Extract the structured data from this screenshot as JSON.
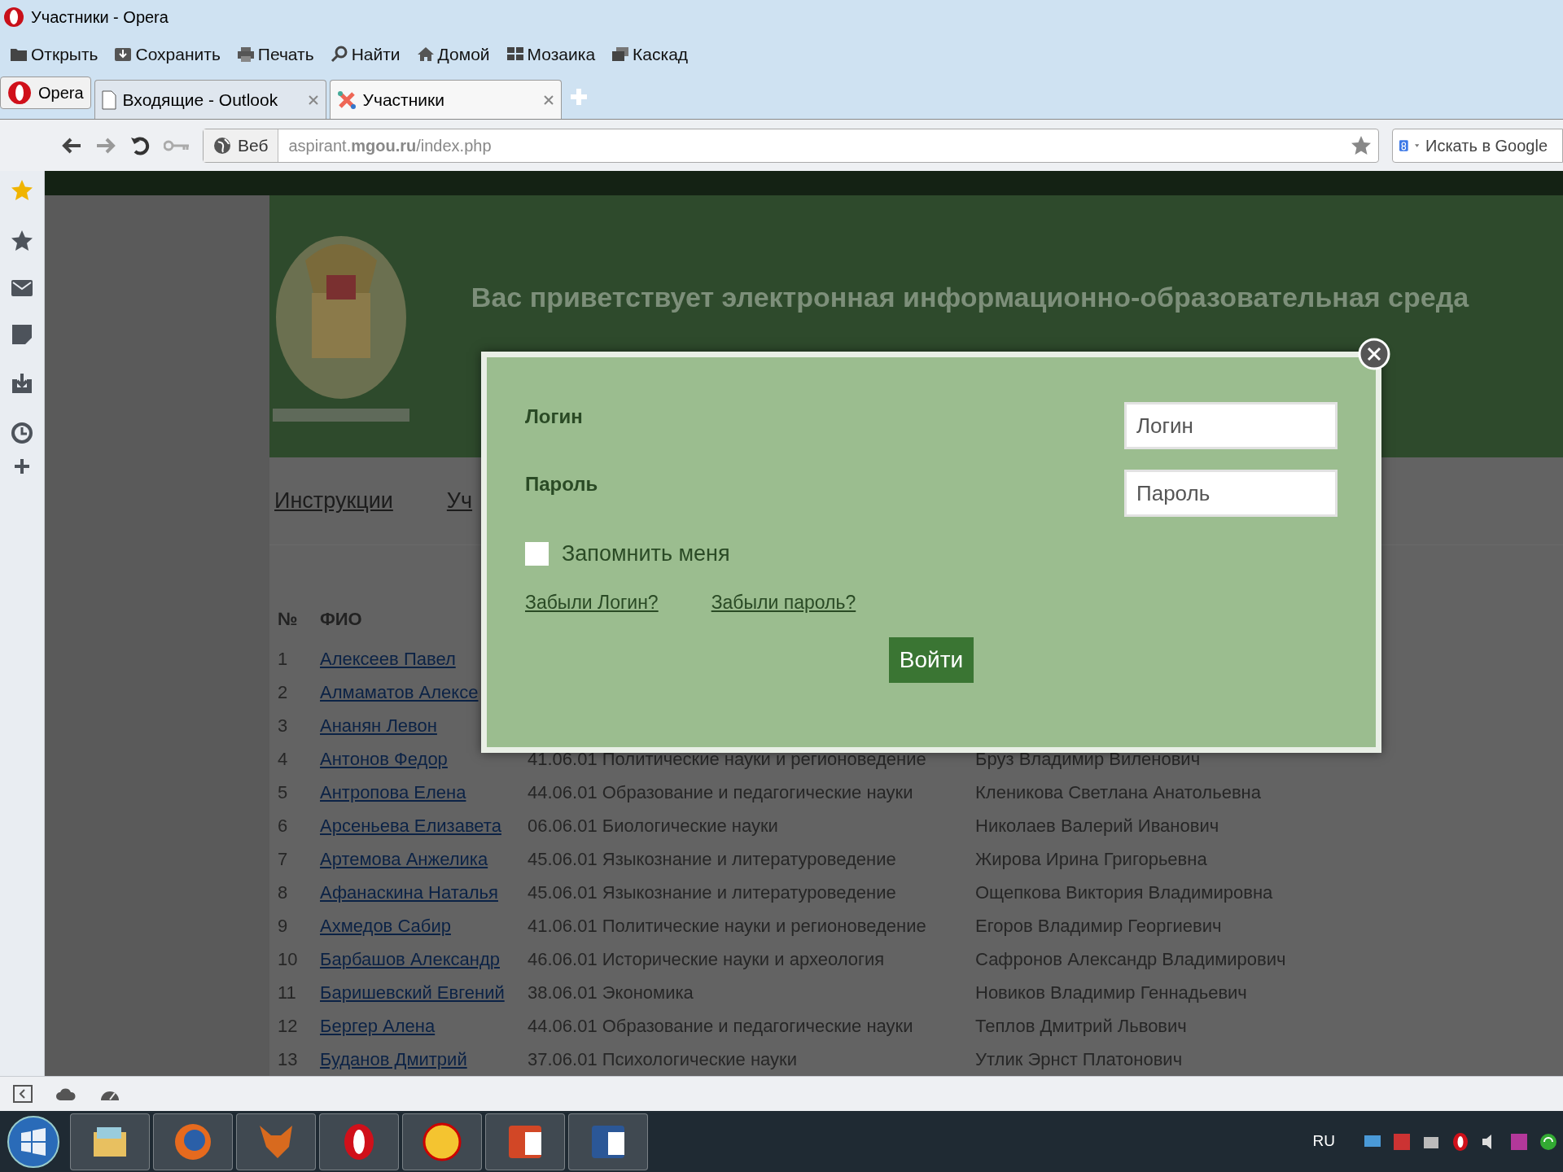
{
  "window": {
    "title": "Участники - Opera"
  },
  "menu": [
    {
      "label": "Открыть",
      "kind": "folder"
    },
    {
      "label": "Сохранить",
      "kind": "save"
    },
    {
      "label": "Печать",
      "kind": "print"
    },
    {
      "label": "Найти",
      "kind": "search"
    },
    {
      "label": "Домой",
      "kind": "home"
    },
    {
      "label": "Мозаика",
      "kind": "tile"
    },
    {
      "label": "Каскад",
      "kind": "cascade"
    }
  ],
  "opera_button": {
    "label": "Opera"
  },
  "tabs": [
    {
      "label": "Входящие - Outlook",
      "kind": "page",
      "selected": false
    },
    {
      "label": "Участники",
      "kind": "site",
      "selected": true
    }
  ],
  "address": {
    "badge": "Веб",
    "url": "aspirant.**mgou.ru**/index.php"
  },
  "search": {
    "placeholder": "Искать в Google"
  },
  "page": {
    "greeting": "Вас приветствует электронная информационно-образовательная среда",
    "nav": [
      "Инструкции",
      "Уч"
    ],
    "table": {
      "columns": [
        "№",
        "ФИО"
      ],
      "rows": [
        {
          "number": "1",
          "name": "Алексеев Павел"
        },
        {
          "number": "2",
          "name": "Алмаматов Алексе"
        },
        {
          "number": "3",
          "name": "Ананян Левон"
        },
        {
          "number": "4",
          "name": "Антонов Федор",
          "direction": "41.06.01 Политические науки и регионоведение",
          "supervisor": "Бруз Владимир Виленович"
        },
        {
          "number": "5",
          "name": "Антропова Елена",
          "direction": "44.06.01 Образование и педагогические науки",
          "supervisor": "Кленикова Светлана Анатольевна"
        },
        {
          "number": "6",
          "name": "Арсеньева Елизавета",
          "direction": "06.06.01 Биологические науки",
          "supervisor": "Николаев Валерий Иванович"
        },
        {
          "number": "7",
          "name": "Артемова Анжелика",
          "direction": "45.06.01 Языкознание и литературоведение",
          "supervisor": "Жирова Ирина Григорьевна"
        },
        {
          "number": "8",
          "name": "Афанаскина Наталья",
          "direction": "45.06.01 Языкознание и литературоведение",
          "supervisor": "Ощепкова Виктория Владимировна"
        },
        {
          "number": "9",
          "name": "Ахмедов Сабир",
          "direction": "41.06.01 Политические науки и регионоведение",
          "supervisor": "Егоров Владимир Георгиевич"
        },
        {
          "number": "10",
          "name": "Барбашов Александр",
          "direction": "46.06.01 Исторические науки и археология",
          "supervisor": "Сафронов Александр Владимирович"
        },
        {
          "number": "11",
          "name": "Баришевский Евгений",
          "direction": "38.06.01 Экономика",
          "supervisor": "Новиков Владимир Геннадьевич"
        },
        {
          "number": "12",
          "name": "Бергер Алена",
          "direction": "44.06.01 Образование и педагогические науки",
          "supervisor": "Теплов Дмитрий Львович"
        },
        {
          "number": "13",
          "name": "Буданов Дмитрий",
          "direction": "37.06.01 Психологические науки",
          "supervisor": "Утлик Эрнст Платонович"
        }
      ]
    }
  },
  "login_dialog": {
    "login_label": "Логин",
    "login_placeholder": "Логин",
    "password_label": "Пароль",
    "password_placeholder": "Пароль",
    "remember": {
      "label": "Запомнить меня",
      "checked": false
    },
    "links": [
      "Забыли Логин?",
      "Забыли пароль?"
    ],
    "submit": "Войти"
  },
  "taskbar": {
    "language": "RU"
  }
}
